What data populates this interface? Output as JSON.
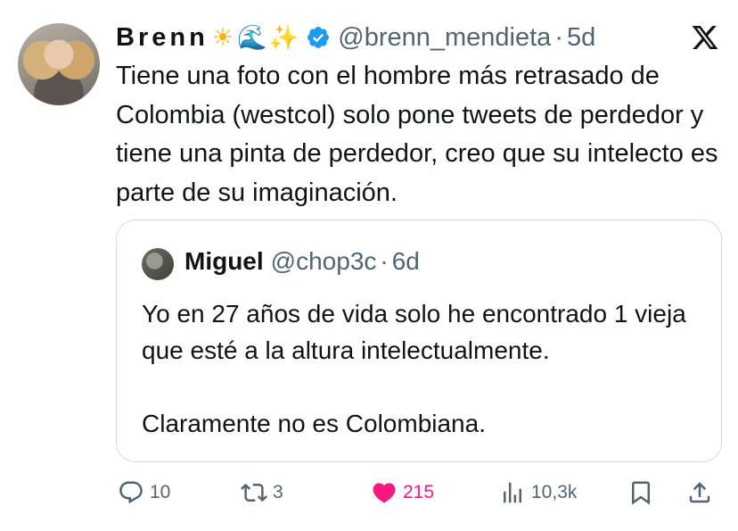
{
  "author": {
    "display_name": "Brenn",
    "emojis": [
      "☀",
      "🌊",
      "✨"
    ],
    "verified": true,
    "handle": "@brenn_mendieta",
    "separator": "·",
    "time": "5d"
  },
  "platform_icon": "x-logo-icon",
  "tweet": {
    "text": "Tiene una foto con el hombre más retrasado de Colombia (westcol) solo pone tweets de perdedor y tiene una pinta de perdedor, creo que su intelecto es parte de su imaginación."
  },
  "quoted_tweet": {
    "name": "Miguel",
    "handle": "@chop3c",
    "separator": "·",
    "time": "6d",
    "paragraphs": [
      "Yo en 27 años de vida solo he encontrado 1 vieja que esté a la altura intelectualmente.",
      "Claramente no es Colombiana."
    ]
  },
  "actions": {
    "replies": "10",
    "retweets": "3",
    "likes": "215",
    "views": "10,3k"
  },
  "colors": {
    "text": "#0f1419",
    "secondary": "#536471",
    "verified": "#1d9bf0",
    "like": "#f91880",
    "border": "#cfd9de"
  }
}
